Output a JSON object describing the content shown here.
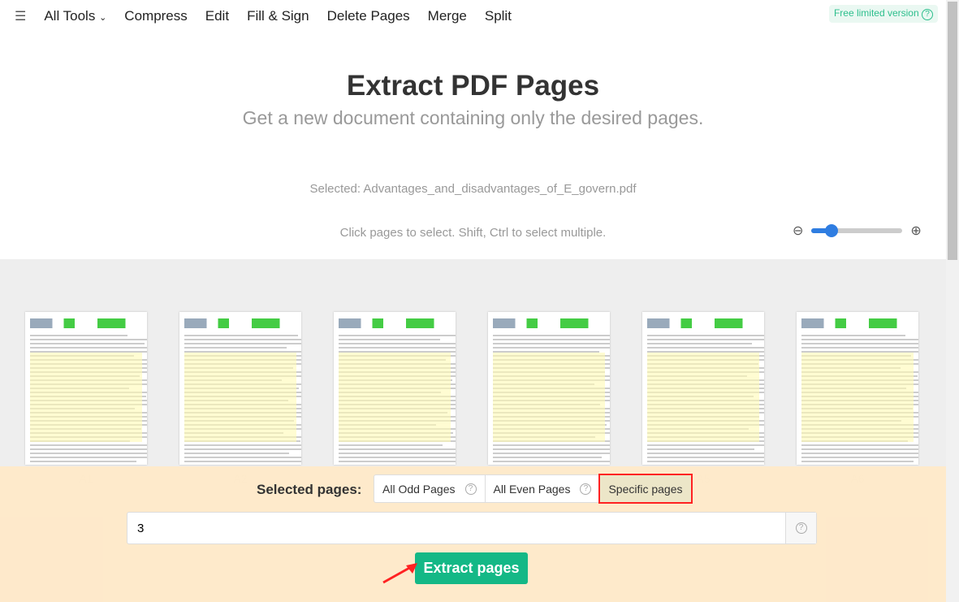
{
  "nav": {
    "items": [
      "All Tools",
      "Compress",
      "Edit",
      "Fill & Sign",
      "Delete Pages",
      "Merge",
      "Split"
    ],
    "badge": "Free limited version"
  },
  "header": {
    "title": "Extract PDF Pages",
    "subtitle": "Get a new document containing only the desired pages.",
    "selected": "Selected: Advantages_and_disadvantages_of_E_govern.pdf",
    "hint": "Click pages to select. Shift, Ctrl to select multiple."
  },
  "zoom": {
    "level": 0.15
  },
  "pages": [
    "A1",
    "A2",
    "A3",
    "A4",
    "A5",
    "A6"
  ],
  "panel": {
    "label": "Selected pages:",
    "options": [
      "All Odd Pages",
      "All Even Pages",
      "Specific pages"
    ],
    "active": "Specific pages",
    "input_value": "3",
    "button": "Extract pages"
  },
  "colors": {
    "accent": "#14b886",
    "highlight": "#ff2222",
    "panel": "#ffe9c8"
  }
}
